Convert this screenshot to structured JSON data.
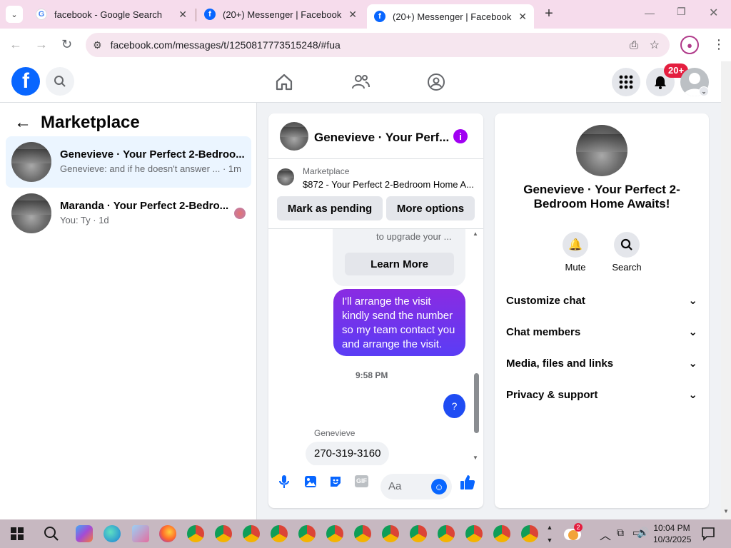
{
  "browser": {
    "tabs": [
      {
        "title": "facebook - Google Search",
        "favicon": "google-icon",
        "active": false
      },
      {
        "title": "(20+) Messenger | Facebook",
        "favicon": "facebook-icon",
        "active": false
      },
      {
        "title": "(20+) Messenger | Facebook",
        "favicon": "facebook-icon",
        "active": true
      }
    ],
    "url": "facebook.com/messages/t/1250817773515248/#fua",
    "new_tab_label": "+"
  },
  "header": {
    "notification_count": "20+"
  },
  "left": {
    "title": "Marketplace",
    "conversations": [
      {
        "name": "Genevieve · Your Perfect 2-Bedroo...",
        "preview": "Genevieve: and if he doesn't answer ...",
        "time": "· 1m",
        "selected": true
      },
      {
        "name": "Maranda · Your Perfect 2-Bedro...",
        "preview": "You: Ty · 1d",
        "time": "",
        "selected": false
      }
    ]
  },
  "chat": {
    "header_name": "Genevieve · Your Perf...",
    "listing_label": "Marketplace",
    "listing_title": "$872 - Your Perfect 2-Bedroom Home A...",
    "mark_pending": "Mark as pending",
    "more_options": "More options",
    "upgrade_text": "to upgrade your ...",
    "learn_more": "Learn More",
    "sent_message": "I'll arrange the visit kindly send the number so my team contact you and arrange the visit.",
    "timestamp": "9:58 PM",
    "sent_short": "?",
    "sender_name": "Genevieve",
    "received_message": "270-319-3160",
    "composer_placeholder": "Aa"
  },
  "info": {
    "name": "Genevieve · Your Perfect 2-Bedroom Home Awaits!",
    "mute_label": "Mute",
    "search_label": "Search",
    "sections": [
      "Customize chat",
      "Chat members",
      "Media, files and links",
      "Privacy & support"
    ]
  },
  "taskbar": {
    "time": "10:04 PM",
    "date": "10/3/2025",
    "weather_badge": "2"
  },
  "colors": {
    "fb_blue": "#0866ff",
    "messenger_purple_top": "#8a2be2",
    "messenger_blue": "#0a7cff",
    "badge_red": "#e41e3f"
  }
}
